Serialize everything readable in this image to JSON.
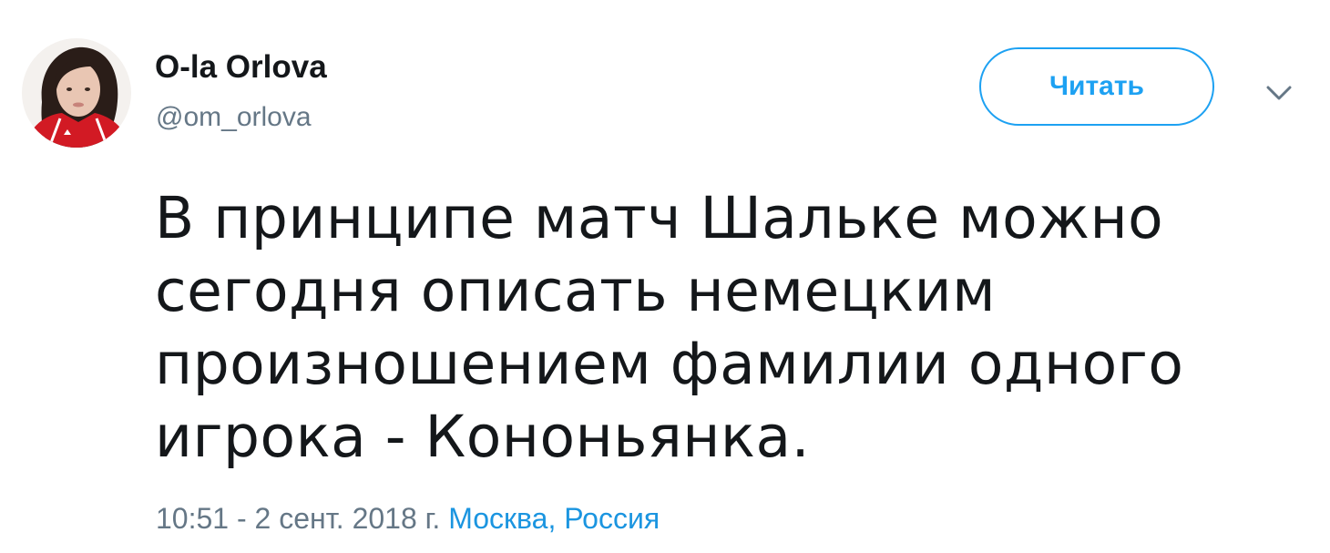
{
  "user": {
    "display_name": "O-la Orlova",
    "handle": "@om_orlova"
  },
  "follow_button": {
    "label": "Читать"
  },
  "tweet": {
    "lines": [
      "В принципе матч Шальке можно",
      "сегодня описать немецким",
      "произношением фамилии одного",
      "игрока - Кононьянка."
    ],
    "timestamp": "10:51 - 2 сент. 2018 г.",
    "location": "Москва, Россия"
  },
  "colors": {
    "accent": "#1da1f2",
    "link": "#1b95e0",
    "text_primary": "#14171a",
    "text_secondary": "#657786",
    "avatar_jacket": "#d21a24"
  },
  "icons": {
    "avatar": "profile-photo",
    "menu": "chevron-down-icon"
  }
}
